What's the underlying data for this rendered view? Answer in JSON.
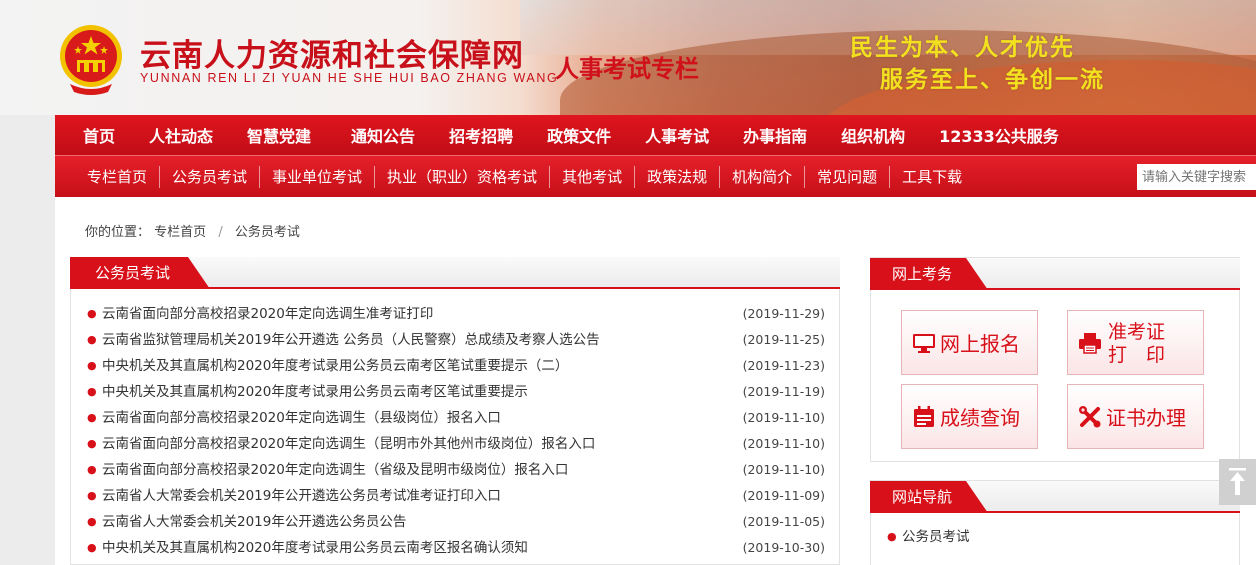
{
  "header": {
    "site_title": "云南人力资源和社会保障网",
    "site_subtitle": "YUNNAN REN LI ZI YUAN HE SHE HUI BAO ZHANG WANG",
    "column_title": "人事考试专栏",
    "slogan_line1": "民生为本、人才优先",
    "slogan_line2": "服务至上、争创一流",
    "emblem_icon": "national-emblem-icon"
  },
  "main_nav": [
    "首页",
    "人社动态",
    "智慧党建",
    "通知公告",
    "招考招聘",
    "政策文件",
    "人事考试",
    "办事指南",
    "组织机构",
    "12333公共服务"
  ],
  "sub_nav": [
    "专栏首页",
    "公务员考试",
    "事业单位考试",
    "执业（职业）资格考试",
    "其他考试",
    "政策法规",
    "机构简介",
    "常见问题",
    "工具下载"
  ],
  "search": {
    "placeholder": "请输入关键字搜索",
    "button_icon": "search-icon"
  },
  "breadcrumb": {
    "prefix": "你的位置：",
    "items": [
      "专栏首页",
      "公务员考试"
    ]
  },
  "news_panel": {
    "title": "公务员考试",
    "items": [
      {
        "title": "云南省面向部分高校招录2020年定向选调生准考证打印",
        "date": "(2019-11-29)"
      },
      {
        "title": "云南省监狱管理局机关2019年公开遴选 公务员（人民警察）总成绩及考察人选公告",
        "date": "(2019-11-25)"
      },
      {
        "title": "中央机关及其直属机构2020年度考试录用公务员云南考区笔试重要提示（二）",
        "date": "(2019-11-23)"
      },
      {
        "title": "中央机关及其直属机构2020年度考试录用公务员云南考区笔试重要提示",
        "date": "(2019-11-19)"
      },
      {
        "title": "云南省面向部分高校招录2020年定向选调生（县级岗位）报名入口",
        "date": "(2019-11-10)"
      },
      {
        "title": "云南省面向部分高校招录2020年定向选调生（昆明市外其他州市级岗位）报名入口",
        "date": "(2019-11-10)"
      },
      {
        "title": "云南省面向部分高校招录2020年定向选调生（省级及昆明市级岗位）报名入口",
        "date": "(2019-11-10)"
      },
      {
        "title": "云南省人大常委会机关2019年公开遴选公务员考试准考证打印入口",
        "date": "(2019-11-09)"
      },
      {
        "title": "云南省人大常委会机关2019年公开遴选公务员公告",
        "date": "(2019-11-05)"
      },
      {
        "title": "中央机关及其直属机构2020年度考试录用公务员云南考区报名确认须知",
        "date": "(2019-10-30)"
      }
    ]
  },
  "exam_panel": {
    "title": "网上考务",
    "buttons": {
      "register": {
        "label": "网上报名",
        "icon": "monitor-icon"
      },
      "admit_line1": "准考证",
      "admit_line2": "打　印",
      "admit_icon": "printer-icon",
      "score": {
        "label": "成绩查询",
        "icon": "calendar-icon"
      },
      "certificate": {
        "label": "证书办理",
        "icon": "tools-icon"
      }
    }
  },
  "site_nav_panel": {
    "title": "网站导航",
    "items": [
      "公务员考试"
    ]
  },
  "back_to_top_icon": "back-to-top-icon",
  "colors": {
    "brand_red": "#d8101a",
    "slogan_yellow": "#f2e11f"
  }
}
